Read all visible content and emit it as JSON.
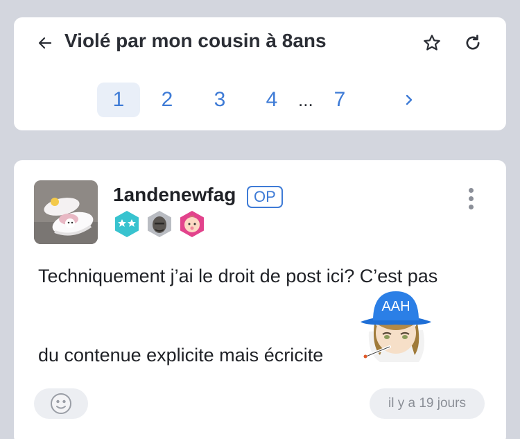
{
  "topic": {
    "title": "Violé par mon cousin à 8ans"
  },
  "pagination": {
    "pages": [
      "1",
      "2",
      "3",
      "4",
      "7"
    ],
    "current": "1",
    "ellipsis": "..."
  },
  "post": {
    "author": "1andenewfag",
    "op_label": "OP",
    "badges": [
      "two-stars-badge",
      "face-badge",
      "baby-badge"
    ],
    "text_line1": "Techniquement j’ai le droit de post ici? C’est pas",
    "text_line2": "du contenue explicite mais écricite",
    "sticker_text": "AAH",
    "timestamp": "il y a 19 jours"
  },
  "colors": {
    "accent": "#3e7bd6",
    "background": "#d3d6de",
    "card": "#ffffff"
  }
}
